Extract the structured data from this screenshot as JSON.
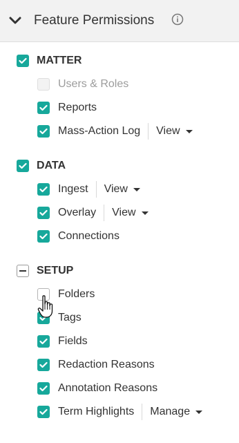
{
  "header": {
    "title": "Feature Permissions",
    "chevron_icon": "chevron-down-icon",
    "info_icon": "info-icon"
  },
  "colors": {
    "check": "#17a89b",
    "header_bg": "#f2f2f2"
  },
  "matter": {
    "label": "MATTER",
    "state": "checked",
    "users_roles": "Users & Roles",
    "reports": "Reports",
    "mass_action_log": "Mass-Action Log",
    "mass_action_log_access": "View"
  },
  "data_section": {
    "label": "DATA",
    "state": "checked",
    "ingest": "Ingest",
    "ingest_access": "View",
    "overlay": "Overlay",
    "overlay_access": "View",
    "connections": "Connections"
  },
  "setup": {
    "label": "SETUP",
    "state": "indeterminate",
    "folders": "Folders",
    "tags": "Tags",
    "fields": "Fields",
    "redaction_reasons": "Redaction Reasons",
    "annotation_reasons": "Annotation Reasons",
    "term_highlights": "Term Highlights",
    "term_highlights_access": "Manage"
  }
}
